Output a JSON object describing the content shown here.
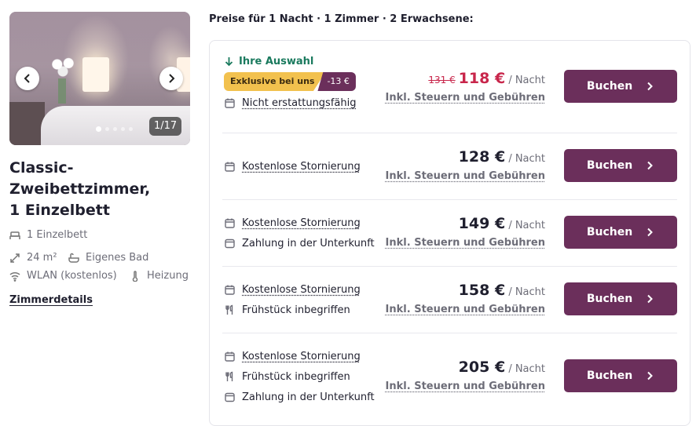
{
  "gallery": {
    "counter": "1/17",
    "dots": 5
  },
  "room": {
    "title_line1": "Classic-Zweibettzimmer,",
    "title_line2": "1 Einzelbett",
    "bed": "1 Einzelbett",
    "size": "24 m²",
    "bathroom": "Eigenes Bad",
    "wifi": "WLAN (kostenlos)",
    "heating": "Heizung",
    "details_link": "Zimmerdetails"
  },
  "prices_heading": "Preise für 1 Nacht · 1 Zimmer · 2 Erwachsene:",
  "common": {
    "per_night": "/ Nacht",
    "tax_note": "Inkl. Steuern und Gebühren",
    "book_label": "Buchen"
  },
  "offers": [
    {
      "selection_label": "Ihre Auswahl",
      "badge_label": "Exklusive bei uns",
      "badge_discount": "-13 €",
      "old_price": "131 €",
      "price": "118 €",
      "options": [
        {
          "icon": "calendar-icon",
          "text": "Nicht erstattungsfähig",
          "underline": true
        }
      ]
    },
    {
      "price": "128 €",
      "options": [
        {
          "icon": "calendar-icon",
          "text": "Kostenlose Stornierung",
          "underline": true
        }
      ]
    },
    {
      "price": "149 €",
      "options": [
        {
          "icon": "calendar-icon",
          "text": "Kostenlose Stornierung",
          "underline": true
        },
        {
          "icon": "wallet-icon",
          "text": "Zahlung in der Unterkunft",
          "underline": false
        }
      ]
    },
    {
      "price": "158 €",
      "options": [
        {
          "icon": "calendar-icon",
          "text": "Kostenlose Stornierung",
          "underline": true
        },
        {
          "icon": "cutlery-icon",
          "text": "Frühstück inbegriffen",
          "underline": false
        }
      ]
    },
    {
      "price": "205 €",
      "options": [
        {
          "icon": "calendar-icon",
          "text": "Kostenlose Stornierung",
          "underline": true
        },
        {
          "icon": "cutlery-icon",
          "text": "Frühstück inbegriffen",
          "underline": false
        },
        {
          "icon": "wallet-icon",
          "text": "Zahlung in der Unterkunft",
          "underline": false
        }
      ]
    }
  ],
  "colors": {
    "brand": "#6b2f5b",
    "selection": "#1a7a5e",
    "discount_price": "#c8264b",
    "badge": "#f2c14e"
  }
}
